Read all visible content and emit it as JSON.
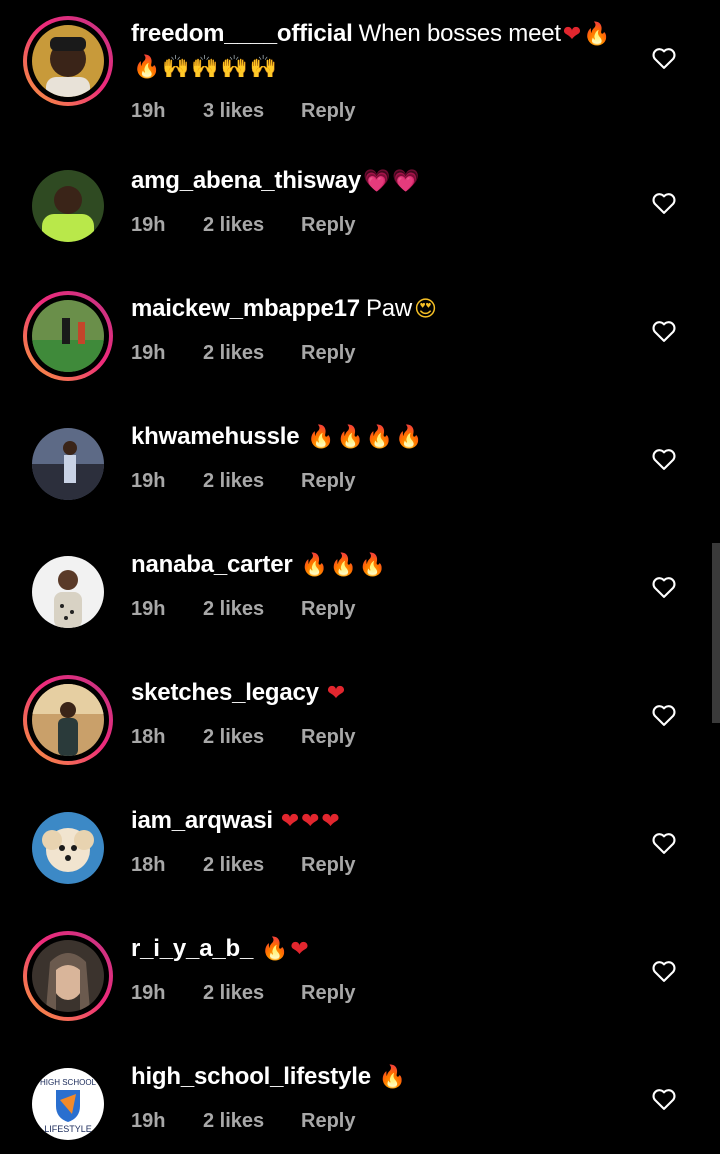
{
  "comments": [
    {
      "username": "freedom____official",
      "text": "When bosses meet",
      "emoji_line1": [
        "heart",
        "fire"
      ],
      "emoji_line2": [
        "fire",
        "hands",
        "hands",
        "hands",
        "hands"
      ],
      "time": "19h",
      "likes": "3 likes",
      "reply": "Reply",
      "story_ring": true,
      "avatar_color": "#c89a3a"
    },
    {
      "username": "amg_abena_thisway",
      "text": "",
      "emoji_line1": [
        "pink-heart",
        "pink-heart"
      ],
      "time": "19h",
      "likes": "2 likes",
      "reply": "Reply",
      "story_ring": false,
      "avatar_color": "#b9e84a"
    },
    {
      "username": "maickew_mbappe17",
      "text": "Paw",
      "emoji_line1": [
        "heart-eyes"
      ],
      "time": "19h",
      "likes": "2 likes",
      "reply": "Reply",
      "story_ring": true,
      "avatar_color": "#3f8a3a"
    },
    {
      "username": "khwamehussle",
      "text": "",
      "emoji_line1": [
        "fire",
        "fire",
        "fire",
        "fire"
      ],
      "time": "19h",
      "likes": "2 likes",
      "reply": "Reply",
      "story_ring": false,
      "avatar_color": "#5d6a86"
    },
    {
      "username": "nanaba_carter",
      "text": "",
      "emoji_line1": [
        "fire",
        "fire",
        "fire"
      ],
      "time": "19h",
      "likes": "2 likes",
      "reply": "Reply",
      "story_ring": false,
      "avatar_color": "#f2f2f2"
    },
    {
      "username": "sketches_legacy",
      "text": "",
      "emoji_line1": [
        "heart"
      ],
      "time": "18h",
      "likes": "2 likes",
      "reply": "Reply",
      "story_ring": true,
      "avatar_color": "#c9a06a"
    },
    {
      "username": "iam_arqwasi",
      "text": "",
      "emoji_line1": [
        "heart",
        "heart",
        "heart"
      ],
      "time": "18h",
      "likes": "2 likes",
      "reply": "Reply",
      "story_ring": false,
      "avatar_color": "#3c89c6"
    },
    {
      "username": "r_i_y_a_b_",
      "text": "",
      "emoji_line1": [
        "fire",
        "heart"
      ],
      "time": "19h",
      "likes": "2 likes",
      "reply": "Reply",
      "story_ring": true,
      "avatar_color": "#6b5a4e"
    },
    {
      "username": "high_school_lifestyle",
      "text": "",
      "emoji_line1": [
        "fire"
      ],
      "time": "19h",
      "likes": "2 likes",
      "reply": "Reply",
      "story_ring": false,
      "avatar_color": "#ffffff",
      "avatar_text_top": "HIGH SCHOOL",
      "avatar_text_bottom": "LIFESTYLE"
    }
  ],
  "like_icon": "heart-outline-icon",
  "colors": {
    "background": "#000000",
    "meta_text": "#a8a8a8",
    "story_ring_start": "#f9a03a",
    "story_ring_end": "#c13584"
  }
}
